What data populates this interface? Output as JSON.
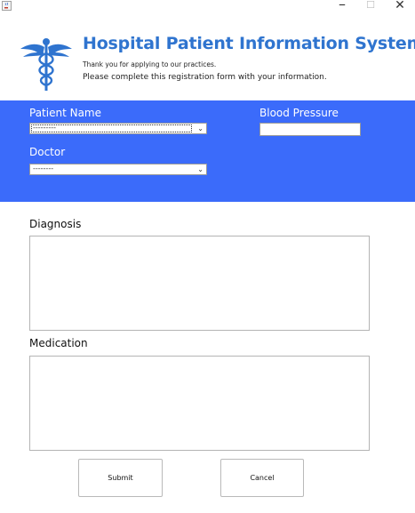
{
  "window": {
    "icon": "java-cup-icon",
    "minimize_glyph": "–",
    "maximize_glyph": "☐",
    "close_glyph": "✕"
  },
  "header": {
    "title": "Hospital Patient Information System",
    "subtitle_1": "Thank you for applying to our practices.",
    "subtitle_2": "Please complete this registration form with your information.",
    "logo": "caduceus-icon"
  },
  "form": {
    "patient_name": {
      "label": "Patient Name",
      "value": "---------"
    },
    "blood_pressure": {
      "label": "Blood Pressure",
      "value": ""
    },
    "doctor": {
      "label": "Doctor",
      "value": "--------"
    },
    "diagnosis": {
      "label": "Diagnosis",
      "value": ""
    },
    "medication": {
      "label": "Medication",
      "value": ""
    }
  },
  "buttons": {
    "submit": "Submit",
    "cancel": "Cancel"
  },
  "colors": {
    "panel": "#3b6bfa",
    "title": "#2f74cf"
  }
}
